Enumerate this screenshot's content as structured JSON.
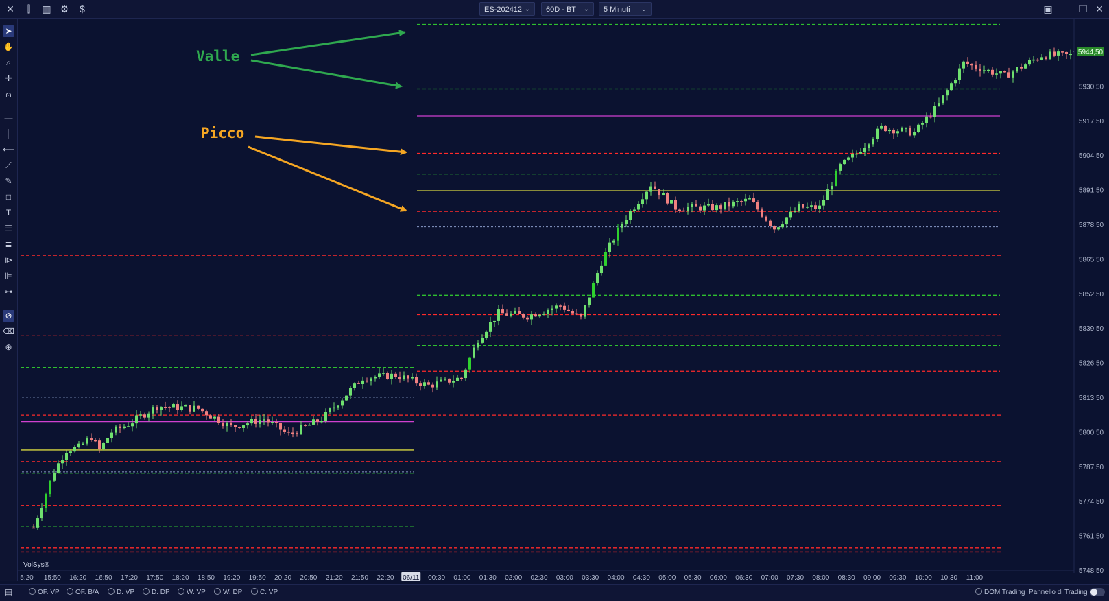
{
  "topbar": {
    "left_icons": [
      "close-icon",
      "compare-icon",
      "bar-chart-icon",
      "gear-icon",
      "dollar-icon"
    ],
    "symbol": "ES-202412",
    "period": "60D - BT",
    "timeframe": "5 Minuti",
    "window_icons": [
      "layout-icon",
      "minimize-icon",
      "restore-icon",
      "close-window-icon"
    ]
  },
  "left_tools": [
    "pointer-icon",
    "hand-icon",
    "zoom-icon",
    "crosshair-icon",
    "magnet-icon",
    "horizontal-line-icon",
    "vertical-line-icon",
    "ray-icon",
    "trend-line-icon",
    "fibonacci-icon",
    "rectangle-icon",
    "text-icon",
    "list-icon",
    "layers-icon",
    "profile-icon",
    "volume-profile-icon",
    "settings-profile-icon",
    "lock-icon",
    "eraser-icon",
    "add-tool-icon"
  ],
  "annotations": {
    "valle": "Valle",
    "picco": "Picco",
    "valle_color": "#2fa84f",
    "picco_color": "#f5a623"
  },
  "watermark": "VolSys®",
  "chart_data": {
    "type": "candlestick",
    "symbol": "ES-202412",
    "ylim": [
      5744,
      5955
    ],
    "y_ticks": [
      "5944,50",
      "5930,50",
      "5917,50",
      "5904,50",
      "5891,50",
      "5878,50",
      "5865,50",
      "5852,50",
      "5839,50",
      "5826,50",
      "5813,50",
      "5800,50",
      "5787,50",
      "5774,50",
      "5761,50",
      "5748,50"
    ],
    "last_price_label": "5944,50",
    "last_price_color": "#2a8a2a",
    "x_ticks": [
      "5:20",
      "15:50",
      "16:20",
      "16:50",
      "17:20",
      "17:50",
      "18:20",
      "18:50",
      "19:20",
      "19:50",
      "20:20",
      "20:50",
      "21:20",
      "21:50",
      "22:20",
      "06/11",
      "00:30",
      "01:00",
      "01:30",
      "02:00",
      "02:30",
      "03:00",
      "03:30",
      "04:00",
      "04:30",
      "05:00",
      "05:30",
      "06:00",
      "06:30",
      "07:00",
      "07:30",
      "08:00",
      "08:30",
      "09:00",
      "09:30",
      "10:00",
      "10:30",
      "11:00"
    ],
    "x_highlight": "06/11",
    "up_color": "#6fe06f",
    "down_color": "#f08080",
    "strong_up_color": "#2fd12f",
    "strong_down_color": "#ff3030",
    "waypoints": [
      [
        0,
        5760
      ],
      [
        5,
        5782
      ],
      [
        8,
        5790
      ],
      [
        11,
        5791
      ],
      [
        14,
        5795
      ],
      [
        16,
        5790
      ],
      [
        19,
        5797
      ],
      [
        23,
        5800
      ],
      [
        30,
        5807
      ],
      [
        40,
        5806
      ],
      [
        48,
        5799
      ],
      [
        56,
        5802
      ],
      [
        62,
        5796
      ],
      [
        70,
        5802
      ],
      [
        80,
        5818
      ],
      [
        88,
        5819
      ],
      [
        96,
        5815
      ],
      [
        104,
        5818
      ],
      [
        108,
        5833
      ],
      [
        113,
        5843
      ],
      [
        120,
        5842
      ],
      [
        128,
        5846
      ],
      [
        133,
        5841
      ],
      [
        138,
        5863
      ],
      [
        143,
        5878
      ],
      [
        150,
        5893
      ],
      [
        156,
        5884
      ],
      [
        166,
        5884
      ],
      [
        174,
        5887
      ],
      [
        180,
        5876
      ],
      [
        186,
        5884
      ],
      [
        191,
        5884
      ],
      [
        196,
        5900
      ],
      [
        200,
        5905
      ],
      [
        206,
        5915
      ],
      [
        214,
        5913
      ],
      [
        220,
        5924
      ],
      [
        226,
        5940
      ],
      [
        230,
        5938
      ],
      [
        236,
        5935
      ],
      [
        245,
        5943
      ],
      [
        252,
        5943
      ]
    ],
    "levels": [
      {
        "price": 5955.0,
        "color": "#2fbf2f",
        "style": "dashed",
        "seg": "right"
      },
      {
        "price": 5950.5,
        "color": "#8a9cc8",
        "style": "dotted",
        "seg": "right"
      },
      {
        "price": 5930.0,
        "color": "#2fbf2f",
        "style": "dashed",
        "seg": "right"
      },
      {
        "price": 5919.5,
        "color": "#d040d0",
        "style": "solid",
        "seg": "right"
      },
      {
        "price": 5905.0,
        "color": "#ff2a2a",
        "style": "dashed",
        "seg": "right"
      },
      {
        "price": 5897.0,
        "color": "#2fbf2f",
        "style": "dashed",
        "seg": "right"
      },
      {
        "price": 5890.5,
        "color": "#d6d640",
        "style": "solid",
        "seg": "right"
      },
      {
        "price": 5882.5,
        "color": "#ff2a2a",
        "style": "dashed",
        "seg": "right"
      },
      {
        "price": 5876.5,
        "color": "#8a9cc8",
        "style": "dotted",
        "seg": "right"
      },
      {
        "price": 5865.5,
        "color": "#ff2a2a",
        "style": "dashed",
        "seg": "full"
      },
      {
        "price": 5850.0,
        "color": "#2fbf2f",
        "style": "dashed",
        "seg": "right"
      },
      {
        "price": 5842.5,
        "color": "#ff2a2a",
        "style": "dashed",
        "seg": "right"
      },
      {
        "price": 5834.5,
        "color": "#ff2a2a",
        "style": "dashed",
        "seg": "full"
      },
      {
        "price": 5830.5,
        "color": "#2fbf2f",
        "style": "dashed",
        "seg": "right"
      },
      {
        "price": 5820.5,
        "color": "#ff2a2a",
        "style": "dashed",
        "seg": "right"
      },
      {
        "price": 5822.0,
        "color": "#2fbf2f",
        "style": "dashed",
        "seg": "left"
      },
      {
        "price": 5810.5,
        "color": "#8a9cc8",
        "style": "dotted",
        "seg": "left"
      },
      {
        "price": 5803.5,
        "color": "#ff2a2a",
        "style": "dashed",
        "seg": "full"
      },
      {
        "price": 5801.0,
        "color": "#d040d0",
        "style": "solid",
        "seg": "left"
      },
      {
        "price": 5790.0,
        "color": "#d6d640",
        "style": "solid",
        "seg": "left"
      },
      {
        "price": 5785.5,
        "color": "#ff2a2a",
        "style": "dashed",
        "seg": "full"
      },
      {
        "price": 5781.5,
        "color": "#8a9cc8",
        "style": "dotted",
        "seg": "left"
      },
      {
        "price": 5781.0,
        "color": "#2fbf2f",
        "style": "dashed",
        "seg": "left"
      },
      {
        "price": 5768.5,
        "color": "#ff2a2a",
        "style": "dashed",
        "seg": "full"
      },
      {
        "price": 5760.5,
        "color": "#2fbf2f",
        "style": "dashed",
        "seg": "left"
      },
      {
        "price": 5752.0,
        "color": "#ff2a2a",
        "style": "dashed",
        "seg": "full"
      },
      {
        "price": 5750.5,
        "color": "#ff2a2a",
        "style": "dashed",
        "seg": "full"
      }
    ]
  },
  "bottombar": {
    "options": [
      "OF. VP",
      "OF. B/A",
      "D. VP",
      "D. DP",
      "W. VP",
      "W. DP",
      "C. VP"
    ],
    "dom_trading": "DOM Trading",
    "panel": "Pannello di Trading"
  }
}
